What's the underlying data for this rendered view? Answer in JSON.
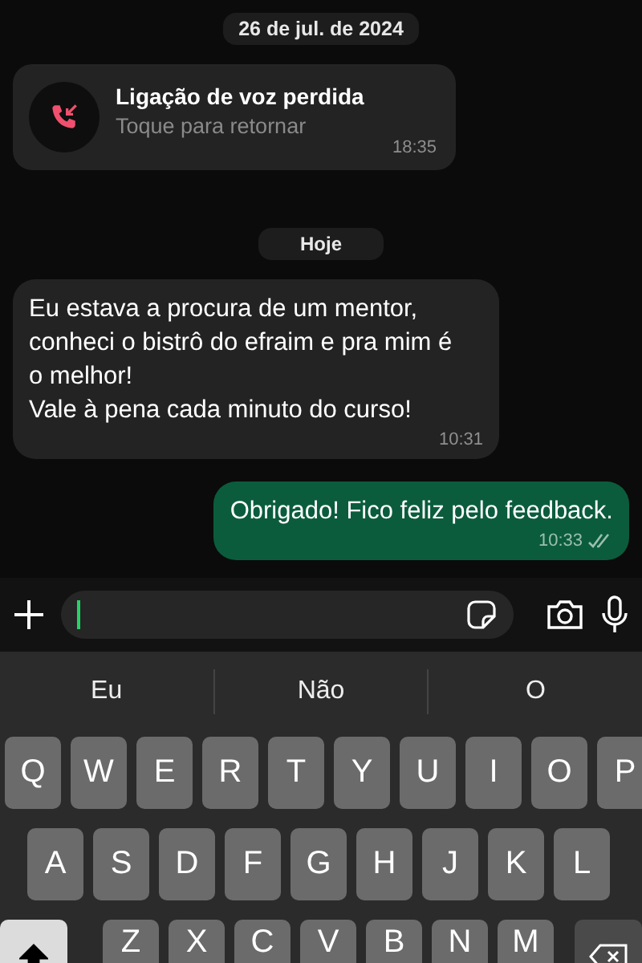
{
  "date_separator": "26 de jul. de 2024",
  "missed_call": {
    "title": "Ligação de voz perdida",
    "subtitle": "Toque para retornar",
    "time": "18:35"
  },
  "day_separator": "Hoje",
  "messages": [
    {
      "kind": "incoming",
      "lines": [
        "Eu estava a procura de um mentor,",
        "conheci o bistrô do efraim e pra mim é",
        "o melhor!",
        "Vale à pena cada minuto do curso!"
      ],
      "time": "10:31",
      "read": false
    },
    {
      "kind": "outgoing",
      "lines": [
        "Obrigado! Fico feliz pelo feedback."
      ],
      "time": "10:33",
      "read": true
    }
  ],
  "composer": {
    "focused": true
  },
  "suggestions": [
    "Eu",
    "Não",
    "O"
  ],
  "keyboard": {
    "rows": [
      [
        "Q",
        "W",
        "E",
        "R",
        "T",
        "Y",
        "U",
        "I",
        "O",
        "P"
      ],
      [
        "A",
        "S",
        "D",
        "F",
        "G",
        "H",
        "J",
        "K",
        "L"
      ],
      [
        "Z",
        "X",
        "C",
        "V",
        "B",
        "N",
        "M"
      ]
    ],
    "shift_on": true
  }
}
